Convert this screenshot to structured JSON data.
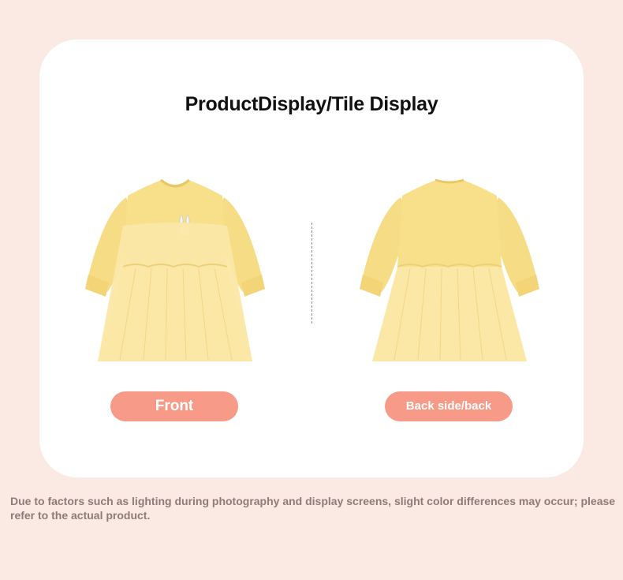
{
  "heading": "ProductDisplay/Tile Display",
  "views": {
    "front_label": "Front",
    "back_label": "Back side/back"
  },
  "dress_color": "#f7e089",
  "tulle_color": "#fbe7a6",
  "accent_color": "#f79a87",
  "disclaimer": "Due to factors such as lighting during photography and display screens, slight color differences may occur; please refer to the actual product."
}
